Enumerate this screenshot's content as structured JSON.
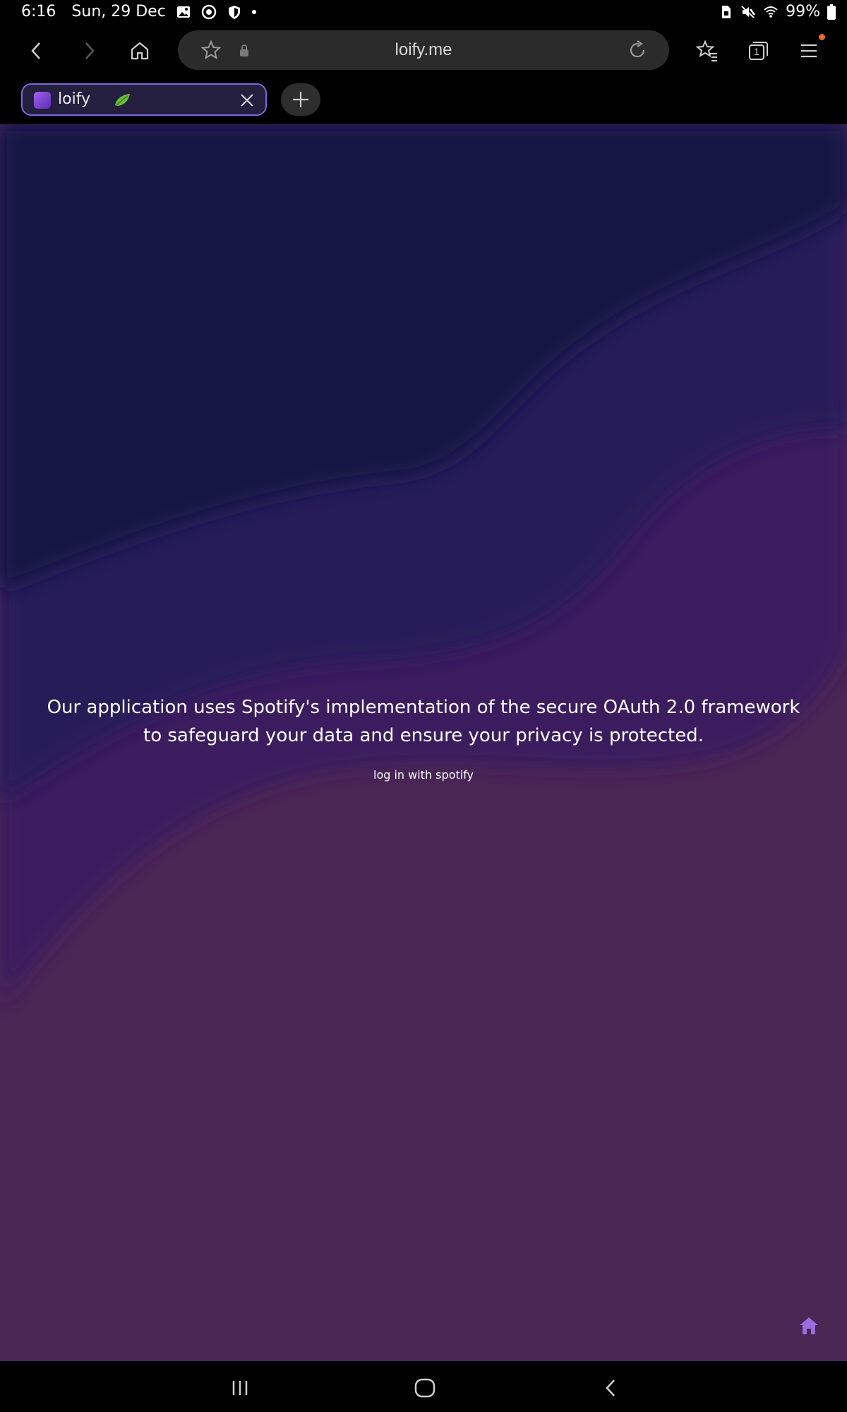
{
  "status_bar": {
    "time": "6:16",
    "date": "Sun, 29 Dec",
    "battery": "99%"
  },
  "browser": {
    "url": "loify.me",
    "tab_title": "loify",
    "tab_count": "1",
    "accent_color": "#7a68d6",
    "menu_notification_color": "#f06a2a"
  },
  "page": {
    "message": "Our application uses Spotify's implementation of the secure OAuth 2.0 framework to safeguard your data and ensure your privacy is protected.",
    "login_link": "log in with spotify",
    "home_icon_color": "#9a6ce0"
  }
}
